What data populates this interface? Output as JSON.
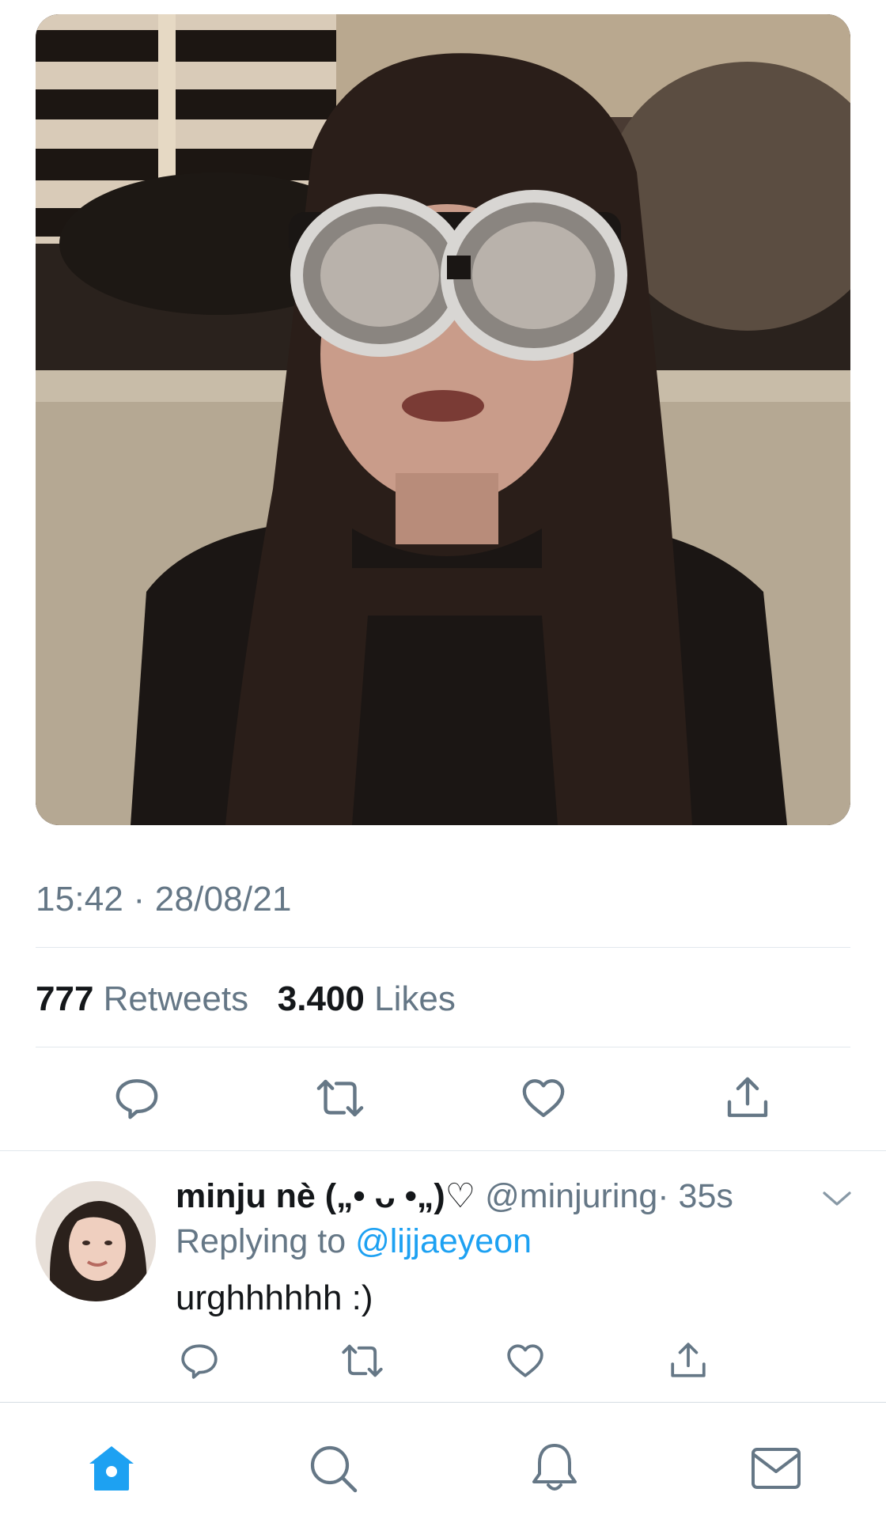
{
  "tweet": {
    "timestamp": "15:42 · 28/08/21",
    "retweets_count": "777",
    "retweets_label": "Retweets",
    "likes_count": "3.400",
    "likes_label": "Likes"
  },
  "actions": [
    "reply-icon",
    "retweet-icon",
    "like-icon",
    "share-icon"
  ],
  "reply": {
    "name": "minju nè („• ᴗ •„)♡",
    "handle": "@minjuring",
    "time": "· 35s",
    "replying_prefix": "Replying to",
    "replying_handle": "@lijjaeyeon",
    "text": "urghhhhhh :)"
  },
  "tabbar": [
    "home-icon",
    "search-icon",
    "notifications-icon",
    "messages-icon"
  ],
  "colors": {
    "accent": "#1da1f2",
    "secondary_text": "#657786",
    "divider": "#e1e8ed"
  }
}
